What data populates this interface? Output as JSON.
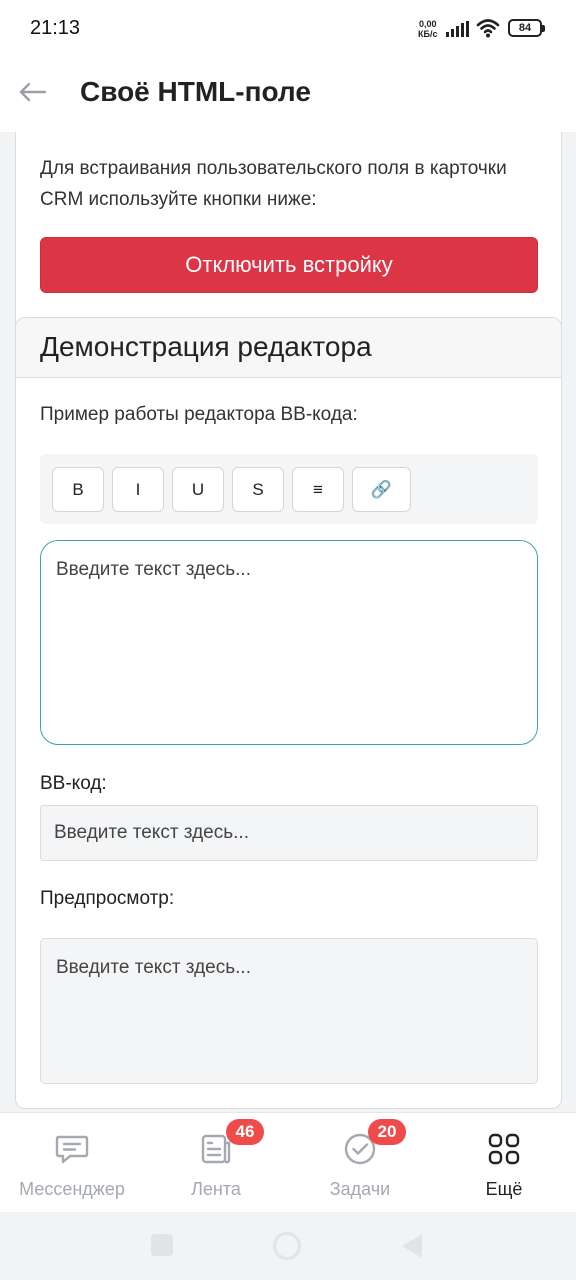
{
  "status_bar": {
    "time": "21:13",
    "net_speed_value": "0,00",
    "net_speed_unit": "КБ/с",
    "battery": "84"
  },
  "header": {
    "title": "Своё HTML-поле",
    "back_icon": "arrow-left-icon"
  },
  "embed_card": {
    "text": "Для встраивания пользовательского поля в карточки CRM используйте кнопки ниже:",
    "disable_button": "Отключить встройку",
    "accent_color": "#dc3545"
  },
  "demo_card": {
    "title": "Демонстрация редактора",
    "example_label": "Пример работы редактора BB-кода:",
    "toolbar": {
      "bold": "B",
      "italic": "I",
      "underline": "U",
      "strike": "S",
      "list": "≡",
      "link": "🔗"
    },
    "editor_placeholder": "Введите текст здесь...",
    "bbcode_label": "BB-код:",
    "bbcode_value": "Введите текст здесь...",
    "preview_label": "Предпросмотр:",
    "preview_text": "Введите текст здесь..."
  },
  "bottom_nav": {
    "items": [
      {
        "label": "Мессенджер",
        "icon": "chat-bubble-icon",
        "badge": ""
      },
      {
        "label": "Лента",
        "icon": "feed-icon",
        "badge": "46"
      },
      {
        "label": "Задачи",
        "icon": "check-circle-icon",
        "badge": "20"
      },
      {
        "label": "Ещё",
        "icon": "grid-icon",
        "badge": ""
      }
    ]
  }
}
